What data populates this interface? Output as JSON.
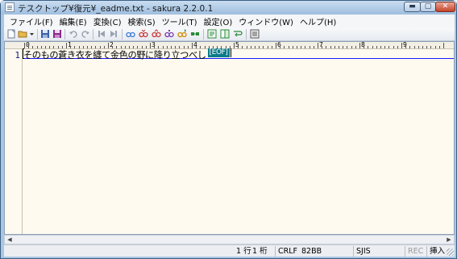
{
  "window": {
    "title": "テスクトップ¥復元¥_eadme.txt - sakura 2.2.0.1",
    "minimize_label": "▬",
    "maximize_label": "▢",
    "close_label": "✕"
  },
  "menu": {
    "items": [
      {
        "label": "ファイル(F)"
      },
      {
        "label": "編集(E)"
      },
      {
        "label": "変換(C)"
      },
      {
        "label": "検索(S)"
      },
      {
        "label": "ツール(T)"
      },
      {
        "label": "設定(O)"
      },
      {
        "label": "ウィンドウ(W)"
      },
      {
        "label": "ヘルプ(H)"
      }
    ]
  },
  "toolbar": {
    "buttons": [
      {
        "icon": "new-file-icon",
        "color": "#ffffff"
      },
      {
        "icon": "open-folder-icon",
        "color": "#e7b94a"
      },
      {
        "icon": "dropdown-arrow-icon",
        "color": "#333333"
      },
      {
        "icon": "save-icon",
        "color": "#3b5fa8"
      },
      {
        "icon": "save-as-icon",
        "color": "#8a2a8a"
      },
      {
        "icon": "undo-icon",
        "color": "#9aa3b0"
      },
      {
        "icon": "redo-icon",
        "color": "#9aa3b0"
      },
      {
        "icon": "back-icon",
        "color": "#9aa3b0"
      },
      {
        "icon": "forward-icon",
        "color": "#9aa3b0"
      },
      {
        "icon": "search-icon",
        "color": "#3a7bd5"
      },
      {
        "icon": "search-next-icon",
        "color": "#c83a3a"
      },
      {
        "icon": "search-prev-icon",
        "color": "#c83a3a"
      },
      {
        "icon": "replace-icon",
        "color": "#7a3ab0"
      },
      {
        "icon": "bookmark-icon",
        "color": "#d08a00"
      },
      {
        "icon": "grep-icon",
        "color": "#2a8a3a"
      },
      {
        "icon": "outline-icon",
        "color": "#2a8a3a"
      },
      {
        "icon": "compare-icon",
        "color": "#2a8a3a"
      },
      {
        "icon": "wrap-icon",
        "color": "#2a8a3a"
      },
      {
        "icon": "settings-icon",
        "color": "#555555"
      }
    ]
  },
  "ruler": {
    "labels": [
      "0",
      "1",
      "2",
      "3",
      "4",
      "5",
      "6",
      "7",
      "8",
      "9"
    ]
  },
  "editor": {
    "line_number": "1",
    "line_text": "そのもの蒼き衣を纏て金色の野に降り立つべし",
    "eof_label": "[EOF]"
  },
  "status": {
    "line": "1 行",
    "column": "1 桁",
    "newline": "CRLF",
    "char_code": "82BB",
    "encoding": "SJIS",
    "rec": "REC",
    "mode": "挿入"
  },
  "colors": {
    "editor_bg": "#fefaef",
    "eof_bg": "#0c7b8a",
    "cursor_line": "#1c1cff"
  }
}
